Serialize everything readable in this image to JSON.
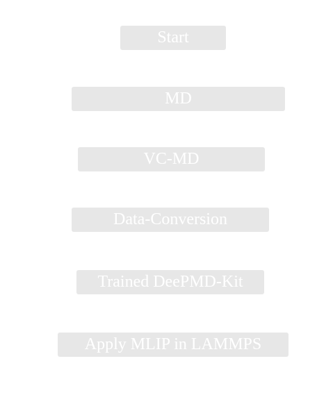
{
  "workflow": {
    "steps": [
      "Start",
      "MD",
      "VC-MD",
      "Data-Conversion",
      "Trained DeePMD-Kit",
      "Apply MLIP in LAMMPS"
    ]
  },
  "colors": {
    "node_fill": "#e7e7e7",
    "node_text": "#ffffff",
    "background": "#ffffff"
  }
}
